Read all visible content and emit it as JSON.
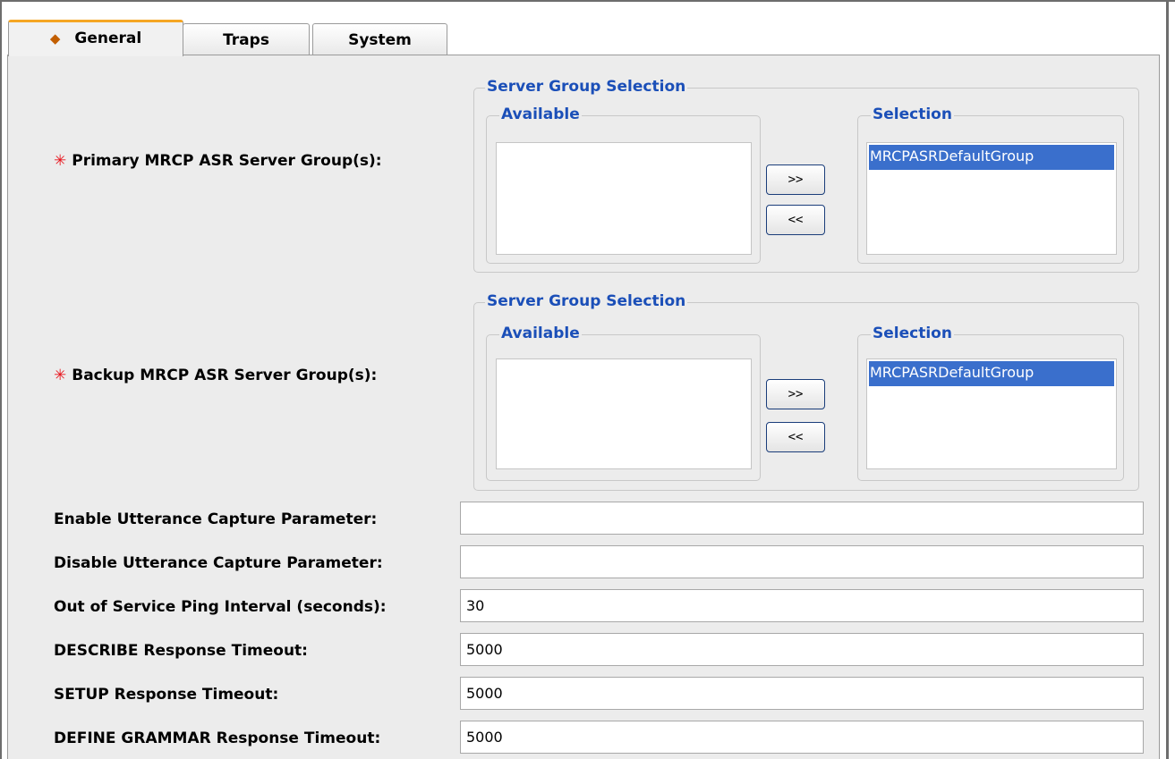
{
  "tabs": [
    {
      "label": "General",
      "active": true
    },
    {
      "label": "Traps",
      "active": false
    },
    {
      "label": "System",
      "active": false
    }
  ],
  "primary_group": {
    "label": "Primary MRCP ASR Server Group(s):",
    "required_marker": "✳",
    "fieldset_title": "Server Group Selection",
    "available_title": "Available",
    "available_items": [],
    "selection_title": "Selection",
    "selection_items": [
      "MRCPASRDefaultGroup"
    ],
    "add_button": ">>",
    "remove_button": "<<"
  },
  "backup_group": {
    "label": "Backup MRCP ASR Server Group(s):",
    "required_marker": "✳",
    "fieldset_title": "Server Group Selection",
    "available_title": "Available",
    "available_items": [],
    "selection_title": "Selection",
    "selection_items": [
      "MRCPASRDefaultGroup"
    ],
    "add_button": ">>",
    "remove_button": "<<"
  },
  "fields": [
    {
      "label": "Enable Utterance Capture Parameter:",
      "value": ""
    },
    {
      "label": "Disable Utterance Capture Parameter:",
      "value": ""
    },
    {
      "label": "Out of Service Ping Interval (seconds):",
      "value": "30"
    },
    {
      "label": "DESCRIBE Response Timeout:",
      "value": "5000"
    },
    {
      "label": "SETUP Response Timeout:",
      "value": "5000"
    },
    {
      "label": "DEFINE GRAMMAR Response Timeout:",
      "value": "5000"
    }
  ],
  "colors": {
    "legend_blue": "#1b4fb8",
    "selection_blue": "#3a6fcc",
    "required_red": "#e8141c",
    "active_tab_accent": "#f5a623"
  },
  "icons": {
    "active_tab_bullet": "diamond-icon",
    "required": "asterisk-icon"
  }
}
